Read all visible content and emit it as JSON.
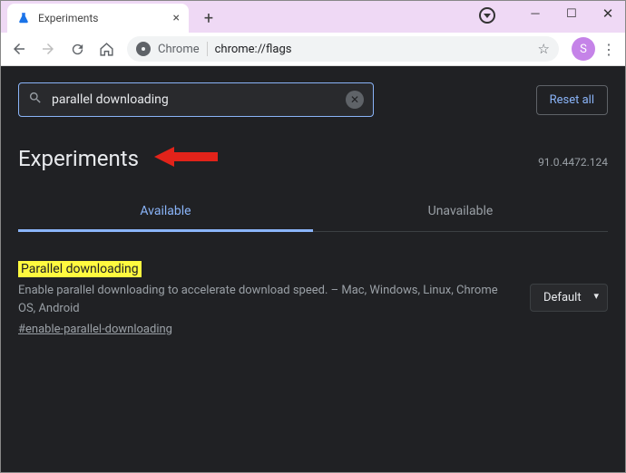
{
  "window": {
    "tab_title": "Experiments",
    "profile_initial": "S"
  },
  "omnibox": {
    "scheme_label": "Chrome",
    "path": "chrome://flags"
  },
  "page": {
    "search_value": "parallel downloading",
    "reset_label": "Reset all",
    "heading": "Experiments",
    "version": "91.0.4472.124",
    "tabs": {
      "available": "Available",
      "unavailable": "Unavailable"
    },
    "flag": {
      "title": "Parallel downloading",
      "description": "Enable parallel downloading to accelerate download speed. – Mac, Windows, Linux, Chrome OS, Android",
      "anchor": "#enable-parallel-downloading",
      "selected": "Default"
    }
  }
}
